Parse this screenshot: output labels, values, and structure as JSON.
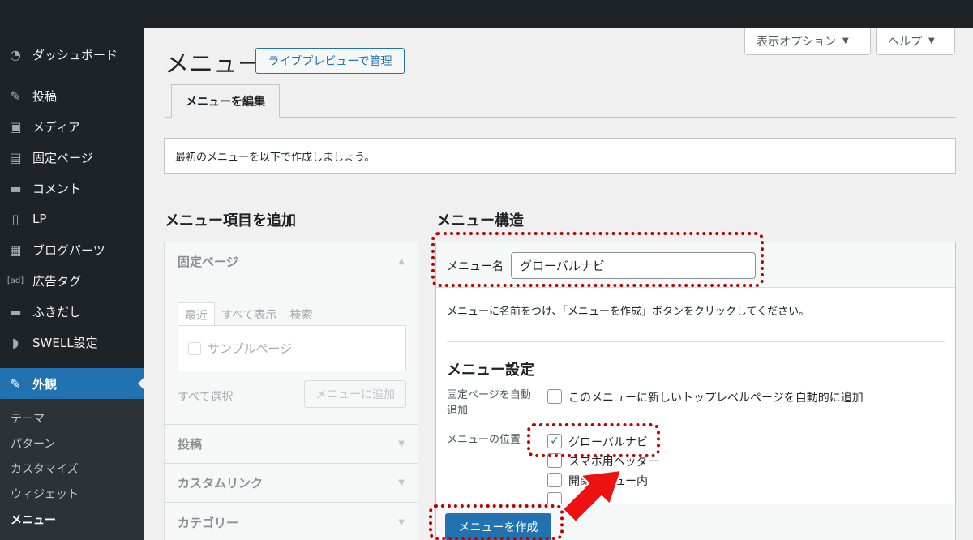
{
  "sidebar": {
    "items": [
      {
        "icon": "dashboard-icon",
        "glyph": "◔",
        "label": "ダッシュボード"
      },
      {
        "icon": "pin-icon",
        "glyph": "✎",
        "label": "投稿"
      },
      {
        "icon": "media-icon",
        "glyph": "▣",
        "label": "メディア"
      },
      {
        "icon": "page-icon",
        "glyph": "▤",
        "label": "固定ページ"
      },
      {
        "icon": "comment-icon",
        "glyph": "▬",
        "label": "コメント"
      },
      {
        "icon": "document-icon",
        "glyph": "▯",
        "label": "LP"
      },
      {
        "icon": "blog-parts-icon",
        "glyph": "▦",
        "label": "ブログパーツ"
      },
      {
        "icon": "ad-icon",
        "glyph": "[ad]",
        "label": "広告タグ"
      },
      {
        "icon": "speech-bubble-icon",
        "glyph": "▬",
        "label": "ふきだし"
      },
      {
        "icon": "swell-icon",
        "glyph": "◗",
        "label": "SWELL設定"
      },
      {
        "icon": "appearance-icon",
        "glyph": "✎",
        "label": "外観"
      }
    ],
    "submenu": [
      "テーマ",
      "パターン",
      "カスタマイズ",
      "ウィジェット",
      "メニュー"
    ]
  },
  "screen_options": {
    "display": "表示オプション",
    "help": "ヘルプ"
  },
  "header": {
    "title": "メニュー",
    "preview_button": "ライブプレビューで管理"
  },
  "tabs": {
    "edit": "メニューを編集"
  },
  "notice": "最初のメニューを以下で作成しましょう。",
  "add_items": {
    "title": "メニュー項目を追加",
    "pages_heading": "固定ページ",
    "mini_tabs": [
      "最近",
      "すべて表示",
      "検索"
    ],
    "sample_page": "サンプルページ",
    "select_all": "すべて選択",
    "add_button": "メニューに追加",
    "posts_heading": "投稿",
    "custom_links_heading": "カスタムリンク",
    "categories_heading": "カテゴリー"
  },
  "structure": {
    "title": "メニュー構造",
    "name_label": "メニュー名",
    "name_value": "グローバルナビ",
    "instructions": "メニューに名前をつけ、「メニューを作成」ボタンをクリックしてください。",
    "settings_title": "メニュー設定",
    "auto_add_label_1": "固定ページを自動",
    "auto_add_label_2": "追加",
    "auto_add_option": "このメニューに新しいトップレベルページを自動的に追加",
    "location_label": "メニューの位置",
    "locations": [
      "グローバルナビ",
      "スマホ用ヘッダー",
      "開閉メニュー内"
    ],
    "create_button": "メニューを作成"
  },
  "colors": {
    "accent": "#2271b1",
    "highlight": "#c00000",
    "arrow": "#ee1111"
  }
}
